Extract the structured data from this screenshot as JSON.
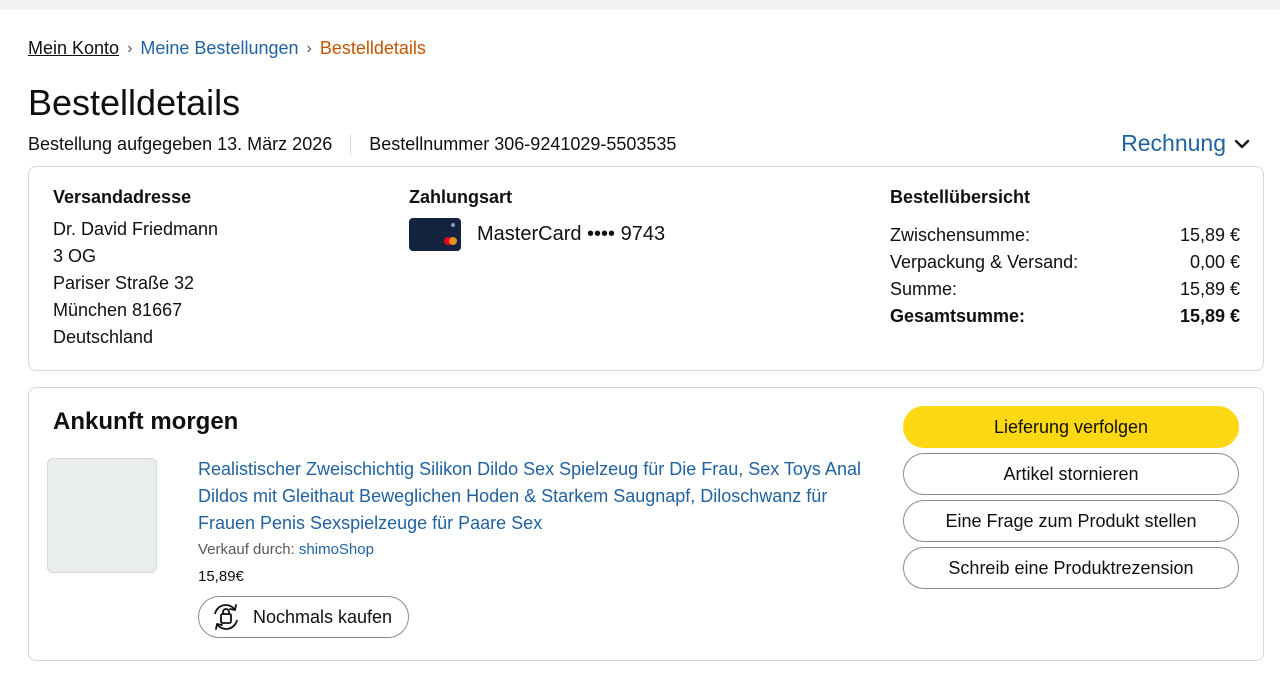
{
  "breadcrumb": {
    "items": [
      "Mein Konto",
      "Meine Bestellungen"
    ],
    "current": "Bestelldetails",
    "separator": "›"
  },
  "page": {
    "title": "Bestelldetails",
    "order_placed": "Bestellung aufgegeben 13. März 2026",
    "order_number": "Bestellnummer 306-9241029-5503535",
    "invoice_label": "Rechnung"
  },
  "shipping": {
    "heading": "Versandadresse",
    "lines": [
      "Dr. David Friedmann",
      "3 OG",
      "Pariser Straße 32",
      "München 81667",
      "Deutschland"
    ]
  },
  "payment": {
    "heading": "Zahlungsart",
    "method": "MasterCard •••• 9743",
    "icon": "mastercard-icon"
  },
  "summary": {
    "heading": "Bestellübersicht",
    "rows": [
      {
        "label": "Zwischensumme:",
        "value": "15,89 €"
      },
      {
        "label": "Verpackung & Versand:",
        "value": "0,00 €"
      },
      {
        "label": "Summe:",
        "value": "15,89 €"
      },
      {
        "label": "Gesamtsumme:",
        "value": "15,89 €"
      }
    ]
  },
  "shipment": {
    "status": "Ankunft morgen",
    "product_title": "Realistischer Zweischichtig Silikon Dildo Sex Spielzeug für Die Frau, Sex Toys Anal Dildos mit Gleithaut Beweglichen Hoden & Starkem Saugnapf, Diloschwanz für Frauen Penis Sexspielzeuge für Paare Sex",
    "sold_by_label": "Verkauf durch:",
    "seller": "shimoShop",
    "price": "15,89€",
    "buy_again_label": "Nochmals kaufen"
  },
  "actions": {
    "track": "Lieferung verfolgen",
    "cancel": "Artikel stornieren",
    "question": "Eine Frage zum Produkt stellen",
    "review": "Schreib eine Produktrezension"
  },
  "colors": {
    "link": "#2162a1",
    "breadcrumb_current": "#c45500",
    "primary_button": "#ffd814",
    "card": "#132340"
  }
}
